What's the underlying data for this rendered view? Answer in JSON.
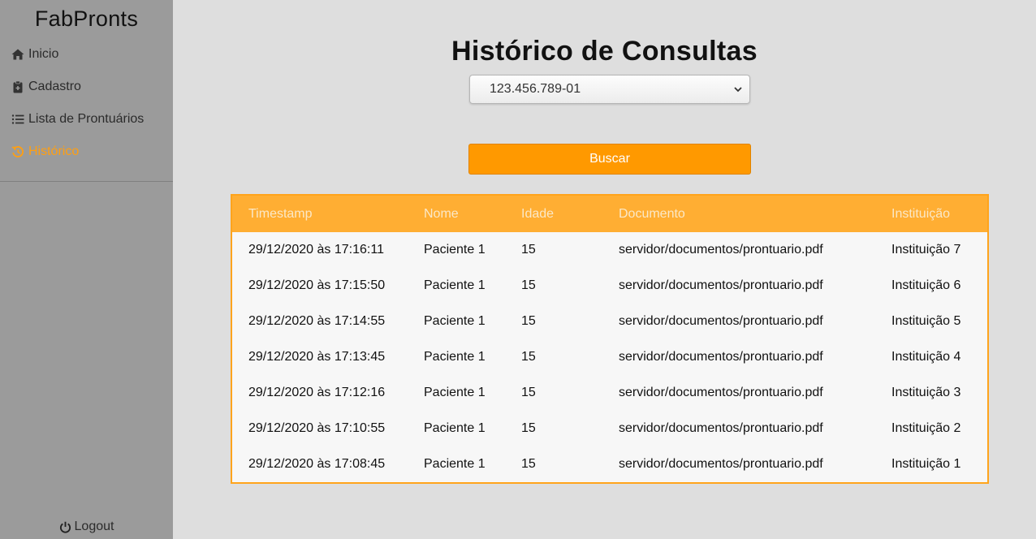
{
  "sidebar": {
    "brand": "FabPronts",
    "items": [
      {
        "label": "Inicio",
        "icon": "home-icon"
      },
      {
        "label": "Cadastro",
        "icon": "clipboard-icon"
      },
      {
        "label": "Lista de Prontuários",
        "icon": "list-icon"
      },
      {
        "label": "Histórico",
        "icon": "history-icon",
        "active": true
      }
    ],
    "logout_label": "Logout"
  },
  "main": {
    "title": "Histórico de Consultas",
    "select_value": "123.456.789-01",
    "search_label": "Buscar",
    "table": {
      "headers": [
        "Timestamp",
        "Nome",
        "Idade",
        "Documento",
        "Instituição"
      ],
      "rows": [
        [
          "29/12/2020 às 17:16:11",
          "Paciente 1",
          "15",
          "servidor/documentos/prontuario.pdf",
          "Instituição 7"
        ],
        [
          "29/12/2020 às 17:15:50",
          "Paciente 1",
          "15",
          "servidor/documentos/prontuario.pdf",
          "Instituição 6"
        ],
        [
          "29/12/2020 às 17:14:55",
          "Paciente 1",
          "15",
          "servidor/documentos/prontuario.pdf",
          "Instituição 5"
        ],
        [
          "29/12/2020 às 17:13:45",
          "Paciente 1",
          "15",
          "servidor/documentos/prontuario.pdf",
          "Instituição 4"
        ],
        [
          "29/12/2020 às 17:12:16",
          "Paciente 1",
          "15",
          "servidor/documentos/prontuario.pdf",
          "Instituição 3"
        ],
        [
          "29/12/2020 às 17:10:55",
          "Paciente 1",
          "15",
          "servidor/documentos/prontuario.pdf",
          "Instituição 2"
        ],
        [
          "29/12/2020 às 17:08:45",
          "Paciente 1",
          "15",
          "servidor/documentos/prontuario.pdf",
          "Instituição 1"
        ]
      ]
    }
  },
  "colors": {
    "accent": "#ff9900",
    "table_header": "#ffae33",
    "sidebar_bg": "#9b9b9b",
    "page_bg": "#dedede",
    "active_nav": "#ff9f12"
  }
}
